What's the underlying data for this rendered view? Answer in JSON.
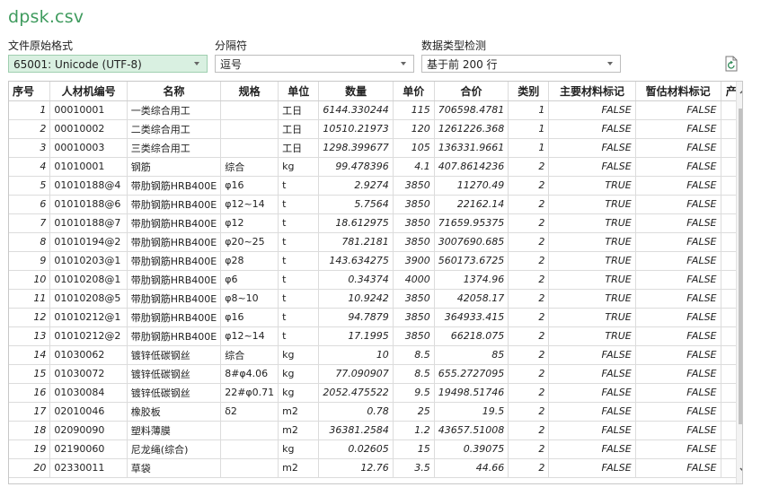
{
  "title": "dpsk.csv",
  "controls": {
    "encoding": {
      "label": "文件原始格式",
      "value": "65001: Unicode (UTF-8)"
    },
    "delimiter": {
      "label": "分隔符",
      "value": "逗号"
    },
    "detection": {
      "label": "数据类型检测",
      "value": "基于前 200 行"
    }
  },
  "icons": {
    "refresh": "refresh-icon",
    "scroll_up": "chevron-up-icon",
    "scroll_down": "chevron-down-icon"
  },
  "table": {
    "headers": [
      "序号",
      "人材机编号",
      "名称",
      "规格",
      "单位",
      "数量",
      "单价",
      "合价",
      "类别",
      "主要材料标记",
      "暂估材料标记",
      "产"
    ],
    "rows": [
      [
        "1",
        "00010001",
        "一类综合用工",
        "",
        "工日",
        "6144.330244",
        "115",
        "706598.4781",
        "1",
        "FALSE",
        "FALSE",
        ""
      ],
      [
        "2",
        "00010002",
        "二类综合用工",
        "",
        "工日",
        "10510.21973",
        "120",
        "1261226.368",
        "1",
        "FALSE",
        "FALSE",
        ""
      ],
      [
        "3",
        "00010003",
        "三类综合用工",
        "",
        "工日",
        "1298.399677",
        "105",
        "136331.9661",
        "1",
        "FALSE",
        "FALSE",
        ""
      ],
      [
        "4",
        "01010001",
        "钢筋",
        "综合",
        "kg",
        "99.478396",
        "4.1",
        "407.8614236",
        "2",
        "FALSE",
        "FALSE",
        ""
      ],
      [
        "5",
        "01010188@4",
        "带肋钢筋HRB400E",
        "φ16",
        "t",
        "2.9274",
        "3850",
        "11270.49",
        "2",
        "TRUE",
        "FALSE",
        ""
      ],
      [
        "6",
        "01010188@6",
        "带肋钢筋HRB400E",
        "φ12~14",
        "t",
        "5.7564",
        "3850",
        "22162.14",
        "2",
        "TRUE",
        "FALSE",
        ""
      ],
      [
        "7",
        "01010188@7",
        "带肋钢筋HRB400E",
        "φ12",
        "t",
        "18.612975",
        "3850",
        "71659.95375",
        "2",
        "TRUE",
        "FALSE",
        ""
      ],
      [
        "8",
        "01010194@2",
        "带肋钢筋HRB400E",
        "φ20~25",
        "t",
        "781.2181",
        "3850",
        "3007690.685",
        "2",
        "TRUE",
        "FALSE",
        ""
      ],
      [
        "9",
        "01010203@1",
        "带肋钢筋HRB400E",
        "φ28",
        "t",
        "143.634275",
        "3900",
        "560173.6725",
        "2",
        "TRUE",
        "FALSE",
        ""
      ],
      [
        "10",
        "01010208@1",
        "带肋钢筋HRB400E",
        "φ6",
        "t",
        "0.34374",
        "4000",
        "1374.96",
        "2",
        "TRUE",
        "FALSE",
        ""
      ],
      [
        "11",
        "01010208@5",
        "带肋钢筋HRB400E",
        "φ8~10",
        "t",
        "10.9242",
        "3850",
        "42058.17",
        "2",
        "TRUE",
        "FALSE",
        ""
      ],
      [
        "12",
        "01010212@1",
        "带肋钢筋HRB400E",
        "φ16",
        "t",
        "94.7879",
        "3850",
        "364933.415",
        "2",
        "TRUE",
        "FALSE",
        ""
      ],
      [
        "13",
        "01010212@2",
        "带肋钢筋HRB400E",
        "φ12~14",
        "t",
        "17.1995",
        "3850",
        "66218.075",
        "2",
        "TRUE",
        "FALSE",
        ""
      ],
      [
        "14",
        "01030062",
        "镀锌低碳钢丝",
        "综合",
        "kg",
        "10",
        "8.5",
        "85",
        "2",
        "FALSE",
        "FALSE",
        ""
      ],
      [
        "15",
        "01030072",
        "镀锌低碳钢丝",
        "8#φ4.06",
        "kg",
        "77.090907",
        "8.5",
        "655.2727095",
        "2",
        "FALSE",
        "FALSE",
        ""
      ],
      [
        "16",
        "01030084",
        "镀锌低碳钢丝",
        "22#φ0.71",
        "kg",
        "2052.475522",
        "9.5",
        "19498.51746",
        "2",
        "FALSE",
        "FALSE",
        ""
      ],
      [
        "17",
        "02010046",
        "橡胶板",
        "δ2",
        "m2",
        "0.78",
        "25",
        "19.5",
        "2",
        "FALSE",
        "FALSE",
        ""
      ],
      [
        "18",
        "02090090",
        "塑料薄膜",
        "",
        "m2",
        "36381.2584",
        "1.2",
        "43657.51008",
        "2",
        "FALSE",
        "FALSE",
        ""
      ],
      [
        "19",
        "02190060",
        "尼龙绳(综合)",
        "",
        "kg",
        "0.02605",
        "15",
        "0.39075",
        "2",
        "FALSE",
        "FALSE",
        ""
      ],
      [
        "20",
        "02330011",
        "草袋",
        "",
        "m2",
        "12.76",
        "3.5",
        "44.66",
        "2",
        "FALSE",
        "FALSE",
        ""
      ]
    ]
  }
}
